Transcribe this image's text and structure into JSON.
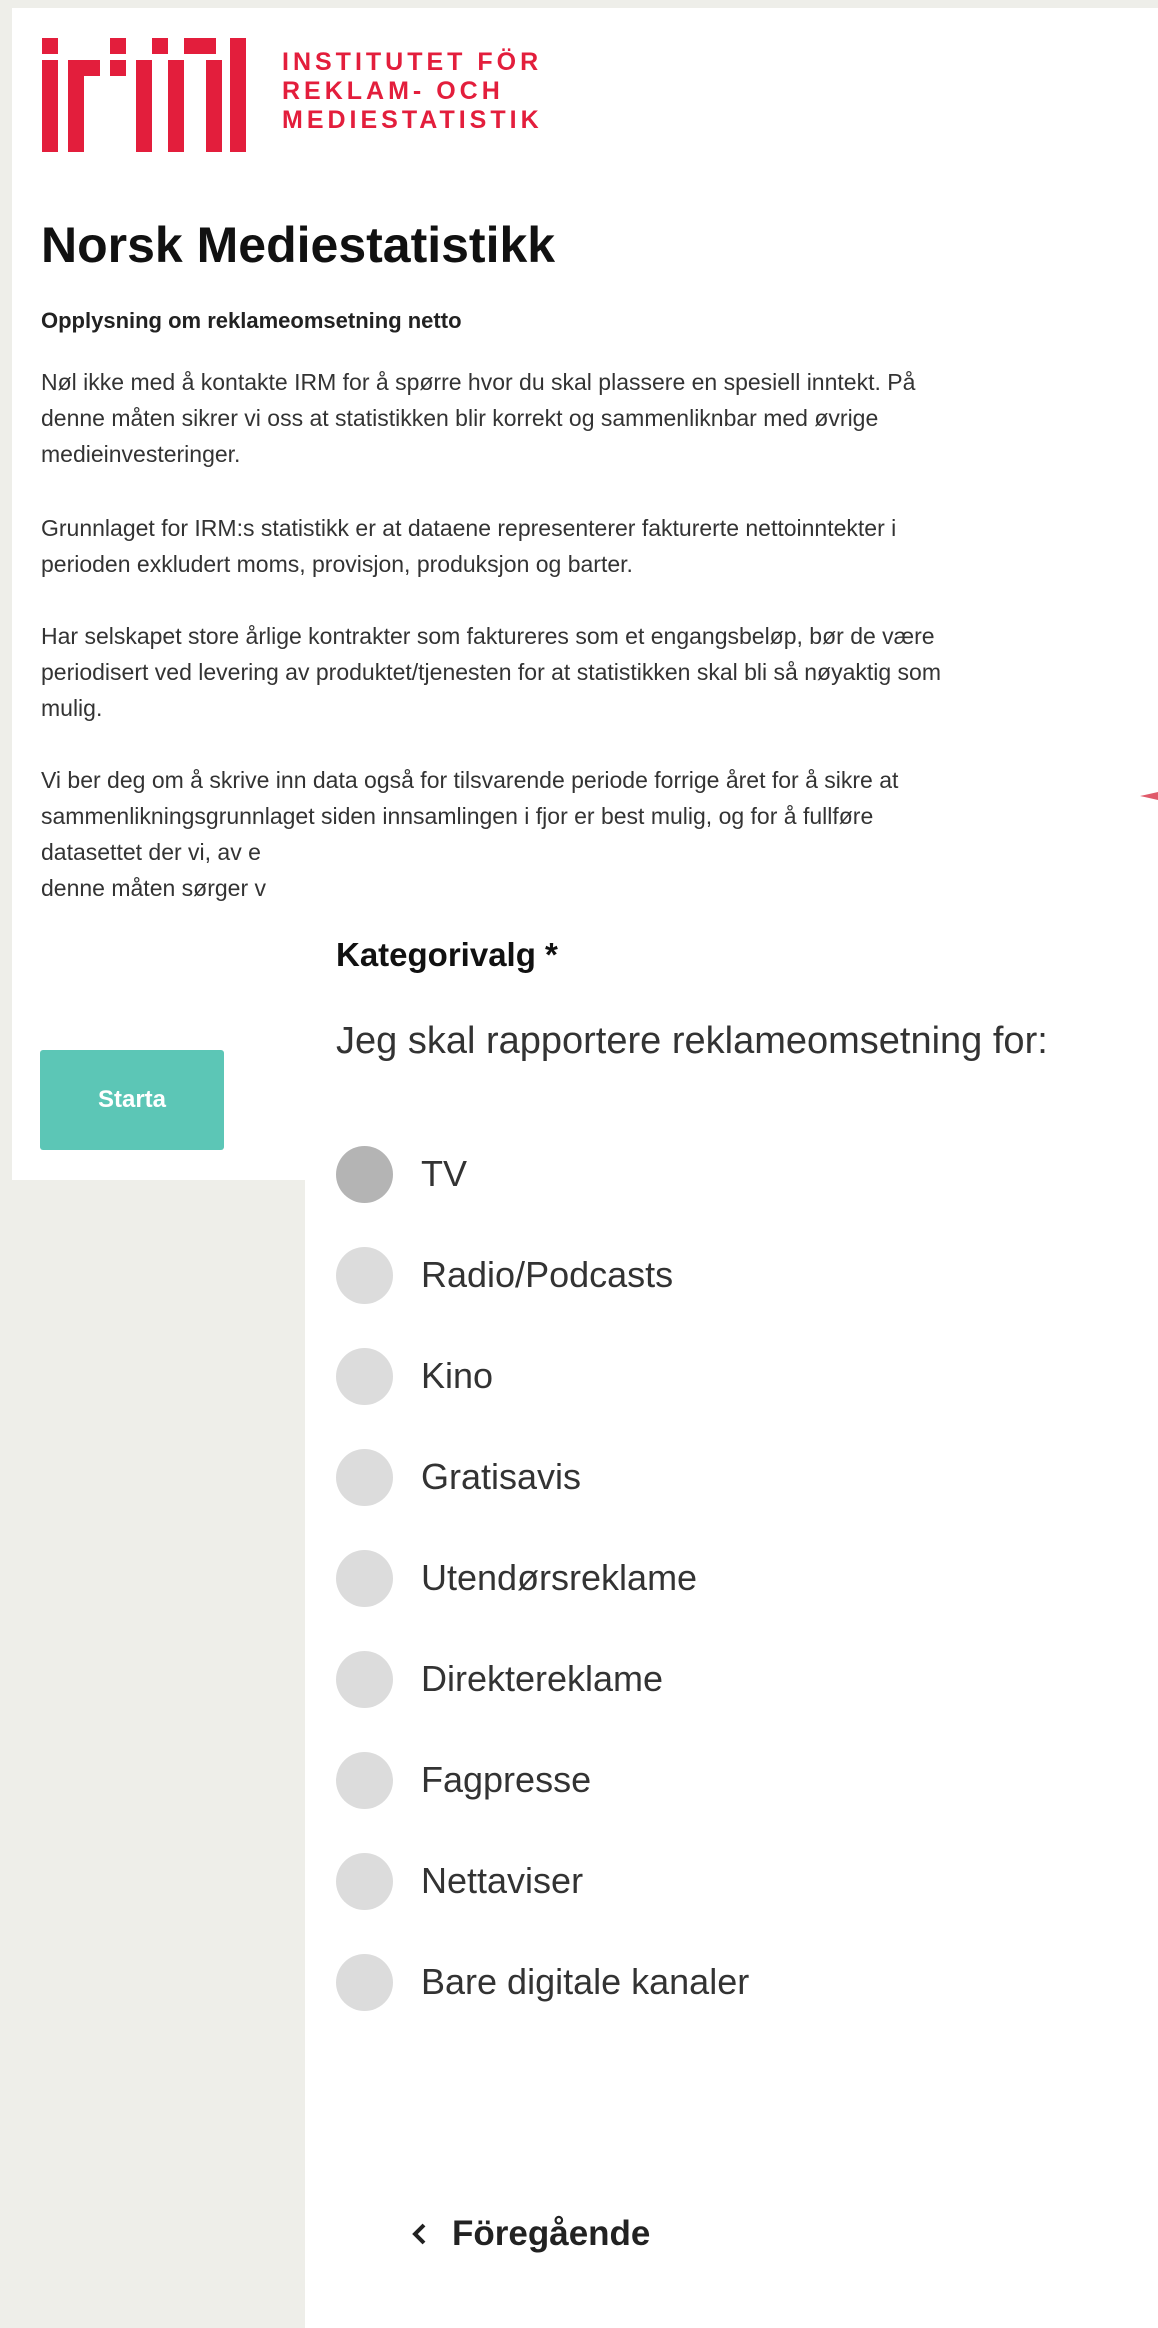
{
  "brand": {
    "logo_text_lines": [
      "INSTITUTET FÖR",
      "REKLAM- OCH",
      "MEDIESTATISTIK"
    ],
    "color": "#e31e3c"
  },
  "intro": {
    "title": "Norsk Mediestatistikk",
    "subtitle": "Opplysning om reklameomsetning netto",
    "paragraphs": [
      [
        "Nøl ikke med å kontakte IRM for å spørre hvor du skal plassere en spesiell inntekt. På",
        "denne måten sikrer vi oss at statistikken blir korrekt og sammenliknbar med øvrige",
        "medieinvesteringer."
      ],
      [
        "Grunnlaget for IRM:s statistikk er at dataene representerer fakturerte nettoinntekter i",
        "perioden exkludert moms, provisjon, produksjon og barter."
      ],
      [
        "Har selskapet store årlige kontrakter som faktureres som et engangsbeløp, bør de være",
        "periodisert ved levering av produktet/tjenesten for at statistikken skal bli så nøyaktig som",
        "mulig."
      ],
      [
        "Vi ber deg om å skrive inn data også for tilsvarende periode forrige året for å sikre at",
        "sammenlikningsgrunnlaget siden innsamlingen i fjor er best mulig, og for å fullføre",
        "datasettet der vi, av e",
        "denne måten sørger v"
      ]
    ],
    "start_label": "Starta",
    "start_color": "#5cc6b6"
  },
  "category": {
    "label": "Kategorivalg *",
    "question": "Jeg skal rapportere reklameomsetning for:",
    "options": [
      "TV",
      "Radio/Podcasts",
      "Kino",
      "Gratisavis",
      "Utendørsreklame",
      "Direktereklame",
      "Fagpresse",
      "Nettaviser",
      "Bare digitale kanaler"
    ],
    "prev_label": "Föregående"
  }
}
